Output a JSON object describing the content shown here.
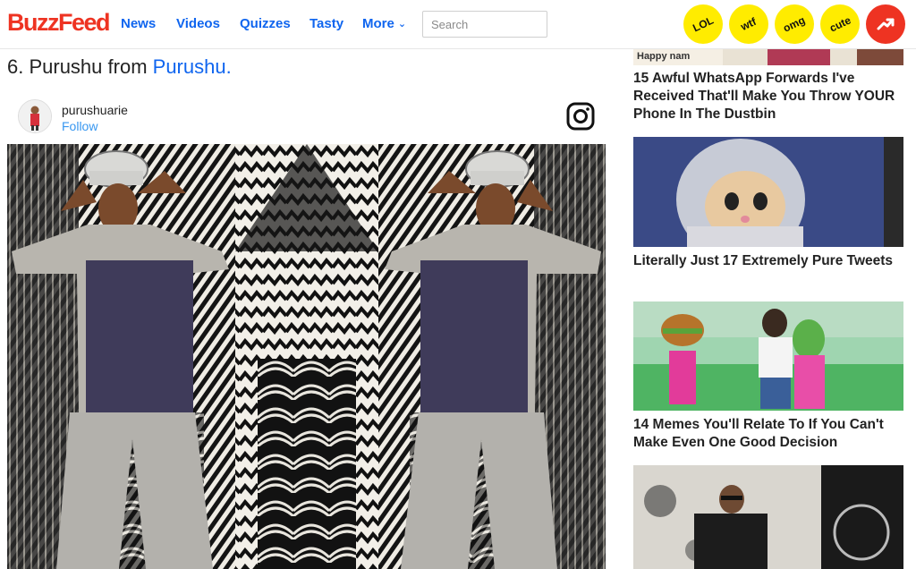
{
  "header": {
    "logo": "BuzzFeed",
    "nav": [
      "News",
      "Videos",
      "Quizzes",
      "Tasty",
      "More"
    ],
    "search_placeholder": "Search",
    "badges": [
      "LOL",
      "wtf",
      "omg",
      "cute"
    ],
    "trending_icon": "trending-arrow-icon"
  },
  "item": {
    "title_prefix": "6. Purushu from ",
    "title_link": "Purushu.",
    "username": "purushuarie",
    "follow_label": "Follow"
  },
  "sidebar": {
    "top_image_text": "Happy nam",
    "items": [
      {
        "title": "15 Awful WhatsApp Forwards I've Received That'll Make You Throw YOUR Phone In The Dustbin"
      },
      {
        "title": "Literally Just 17 Extremely Pure Tweets"
      },
      {
        "title": "14 Memes You'll Relate To If You Can't Make Even One Good Decision"
      }
    ]
  },
  "colors": {
    "brand_red": "#ee3322",
    "link_blue": "#0f65ef",
    "badge_yellow": "#ffec00",
    "follow_blue": "#3897f0"
  }
}
